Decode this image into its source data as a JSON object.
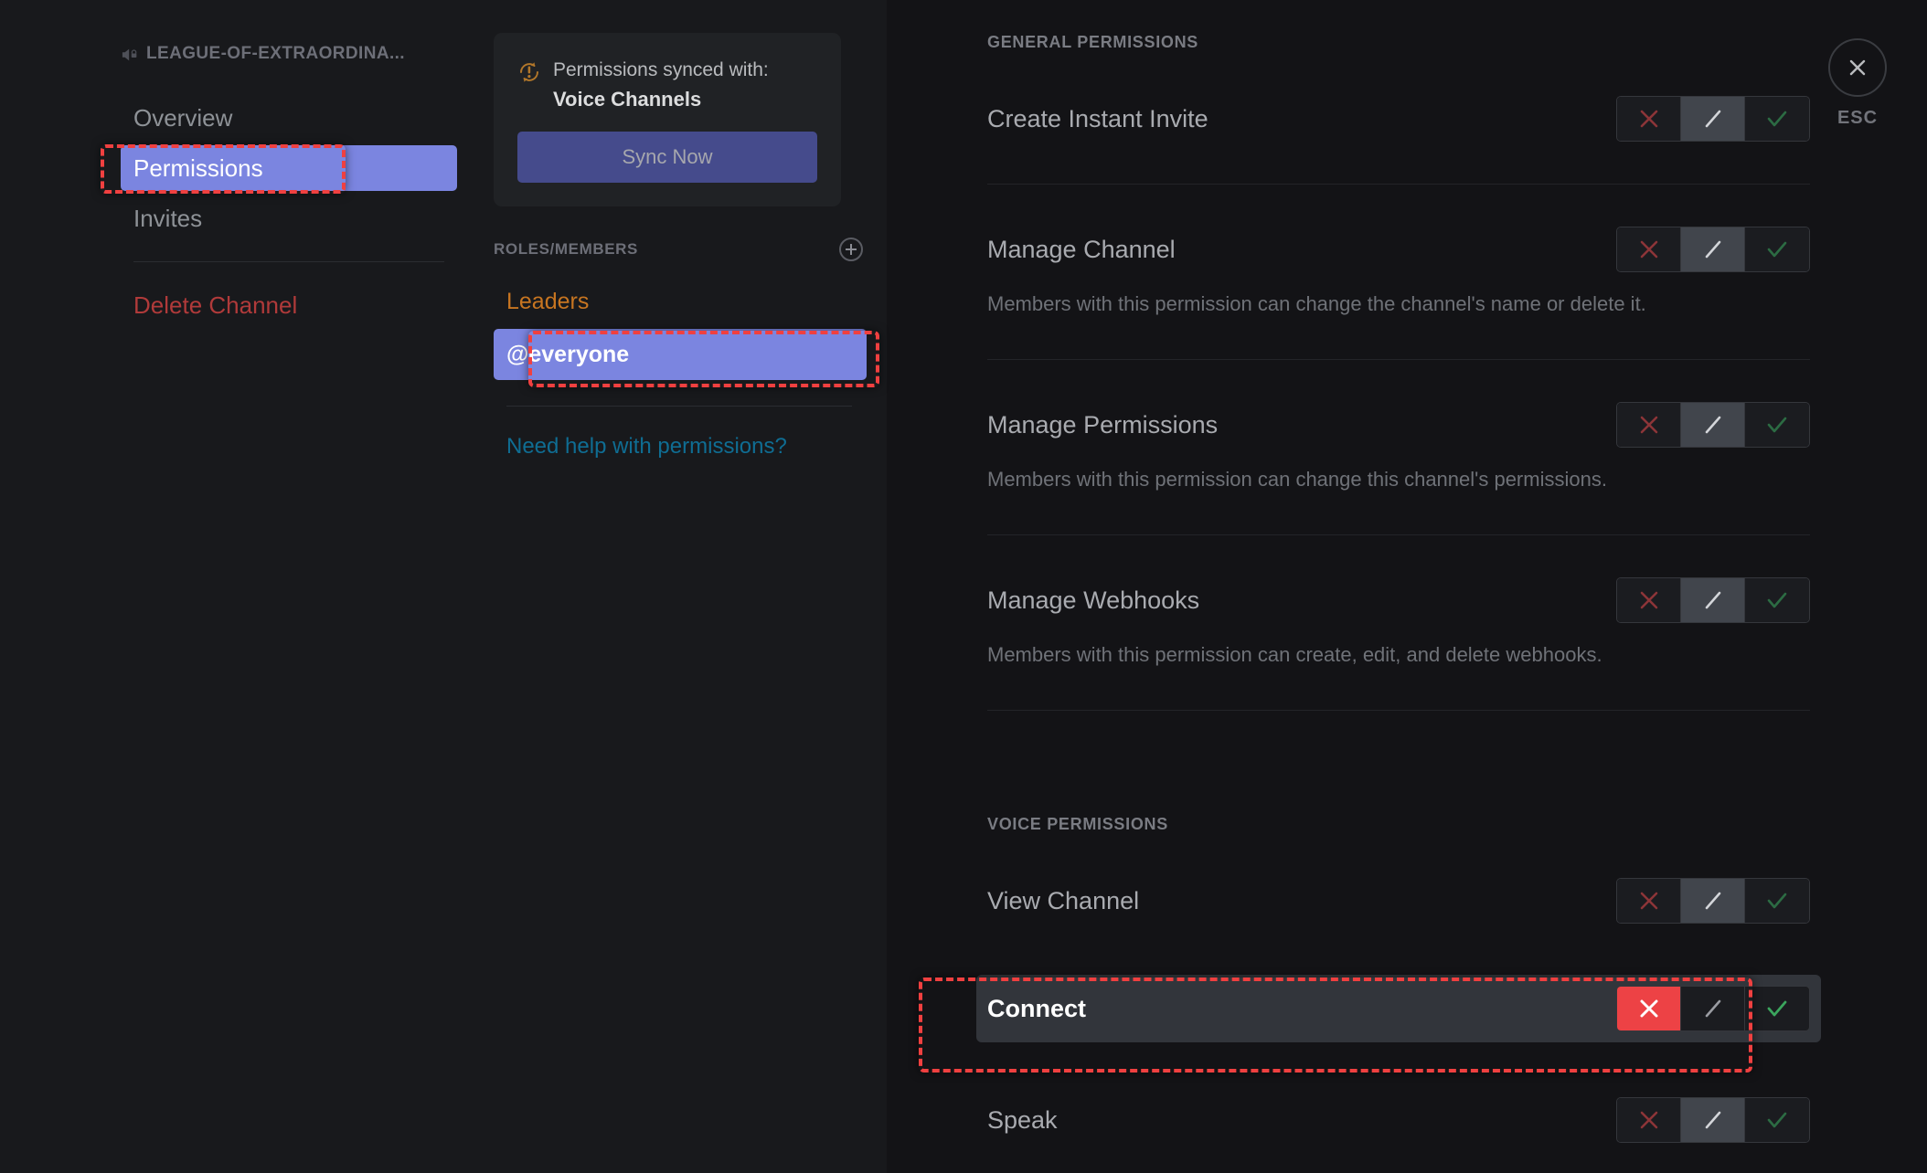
{
  "sidebar": {
    "channel_name": "LEAGUE-OF-EXTRAORDINA...",
    "channel_icon": "voice-locked-icon",
    "items": [
      {
        "label": "Overview",
        "active": false
      },
      {
        "label": "Permissions",
        "active": true
      },
      {
        "label": "Invites",
        "active": false
      }
    ],
    "danger_item": "Delete Channel"
  },
  "sync_card": {
    "icon": "warning-sync-icon",
    "notice": "Permissions synced with:",
    "target": "Voice Channels",
    "button_label": "Sync Now"
  },
  "roles_panel": {
    "header": "ROLES/MEMBERS",
    "add_icon": "plus-circle-icon",
    "roles": [
      {
        "label": "Leaders",
        "color": "#c77521",
        "selected": false
      },
      {
        "label": "@everyone",
        "color": "#ffffff",
        "selected": true
      }
    ],
    "help_link": "Need help with permissions?"
  },
  "permissions": {
    "general_header": "GENERAL PERMISSIONS",
    "voice_header": "VOICE PERMISSIONS",
    "general_items": [
      {
        "label": "Create Instant Invite",
        "description": "",
        "state": "neutral",
        "hovered": false
      },
      {
        "label": "Manage Channel",
        "description": "Members with this permission can change the channel's name or delete it.",
        "state": "neutral",
        "hovered": false
      },
      {
        "label": "Manage Permissions",
        "description": "Members with this permission can change this channel's permissions.",
        "state": "neutral",
        "hovered": false
      },
      {
        "label": "Manage Webhooks",
        "description": "Members with this permission can create, edit, and delete webhooks.",
        "state": "neutral",
        "hovered": false
      }
    ],
    "voice_items": [
      {
        "label": "View Channel",
        "description": "",
        "state": "neutral",
        "hovered": false
      },
      {
        "label": "Connect",
        "description": "",
        "state": "deny",
        "hovered": true
      },
      {
        "label": "Speak",
        "description": "",
        "state": "neutral",
        "hovered": false
      }
    ],
    "toggle_options": [
      {
        "name": "deny-button",
        "icon": "x-icon"
      },
      {
        "name": "neutral-button",
        "icon": "slash-icon"
      },
      {
        "name": "allow-button",
        "icon": "check-icon"
      }
    ]
  },
  "close": {
    "icon": "close-x-icon",
    "label": "ESC"
  },
  "colors": {
    "accent_selected": "#7b85e0",
    "deny_red": "#ed4245",
    "allow_green": "#3ba55d",
    "role_leaders": "#c77521",
    "link_blue": "#0f6d93",
    "danger_red": "#b03a3a",
    "annotation": "#f04040"
  }
}
